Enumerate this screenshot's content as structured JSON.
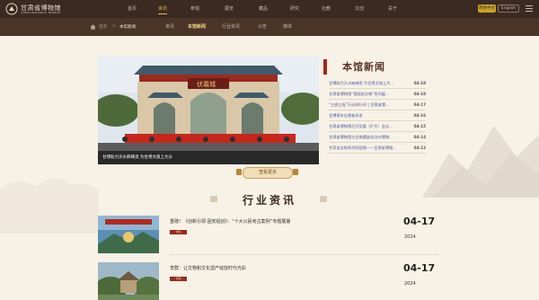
{
  "header": {
    "logo_text": "甘肃省博物馆",
    "logo_subtitle": "GANSU PROVINCIAL MUSEUM",
    "nav": [
      "首页",
      "资讯",
      "参观",
      "展览",
      "藏品",
      "研究",
      "社教",
      "文创",
      "关于"
    ],
    "active_nav": "资讯",
    "lang_cn": "简体中文",
    "lang_en": "English"
  },
  "subnav": {
    "breadcrumb_home": "首页",
    "breadcrumb_sep": ">",
    "breadcrumb_current": "本馆新闻",
    "tabs": [
      "资讯",
      "本馆新闻",
      "行业资讯",
      "公告",
      "媒体"
    ],
    "active_tab": "本馆新闻"
  },
  "hero": {
    "caption": "甘博助力天水麻辣烫 为甘肃文旅上大分",
    "banner_text": "伏羲城"
  },
  "news": {
    "title": "本馆新闻",
    "items": [
      {
        "title": "甘博助力天水麻辣烫 为甘肃文旅上大...",
        "date": "04-18"
      },
      {
        "title": "甘肃省博物馆“我陪跃文物”系列展...",
        "date": "04-18"
      },
      {
        "title": "“三抓三促”行动进行时 | 甘肃省博...",
        "date": "04-17"
      },
      {
        "title": "甘博青年志愿者风采",
        "date": "04-16"
      },
      {
        "title": "甘肃省博物馆召开党委（扩大）会议...",
        "date": "04-15"
      },
      {
        "title": "甘肃省博物馆与甘南藏族自治州博物...",
        "date": "04-14"
      },
      {
        "title": "专家谈文物系列短视频——甘肃省博物...",
        "date": "04-12"
      }
    ],
    "more_label": "查看更多"
  },
  "industry": {
    "title": "行业资讯",
    "items": [
      {
        "title": "重磅！《创新引领·固安铝创》：“十大公民考古案例”专题展播",
        "tag": "详情",
        "date": "04-17",
        "year": "2024"
      },
      {
        "title": "李群：让文物和文化遗产绽放时代光彩",
        "tag": "详情",
        "date": "04-17",
        "year": "2024"
      }
    ]
  },
  "colors": {
    "topnav": "#3a2a22",
    "subnav": "#4a3528",
    "accent_gold": "#e8b94a",
    "accent_red": "#9b2a1e",
    "paper": "#f7f1e6"
  }
}
